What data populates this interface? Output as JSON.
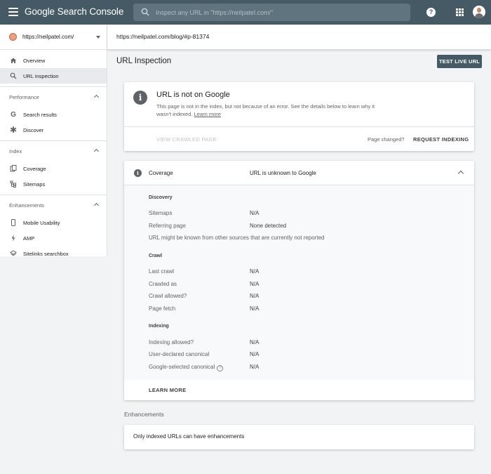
{
  "app": {
    "brand": "Google Search Console"
  },
  "search": {
    "placeholder": "Inspect any URL in \"https://neilpatel.com/\""
  },
  "sidebar": {
    "property": "https://neilpatel.com/",
    "top_items": [
      {
        "label": "Overview",
        "icon": "home-icon"
      },
      {
        "label": "URL inspection",
        "icon": "search-icon",
        "active": true
      }
    ],
    "sections": [
      {
        "title": "Performance",
        "items": [
          {
            "label": "Search results",
            "icon": "google-g-icon"
          },
          {
            "label": "Discover",
            "icon": "asterisk-icon"
          }
        ]
      },
      {
        "title": "Index",
        "items": [
          {
            "label": "Coverage",
            "icon": "file-copy-icon"
          },
          {
            "label": "Sitemaps",
            "icon": "sitemap-icon"
          }
        ]
      },
      {
        "title": "Enhancements",
        "items": [
          {
            "label": "Mobile Usability",
            "icon": "phone-icon"
          },
          {
            "label": "AMP",
            "icon": "bolt-icon"
          },
          {
            "label": "Sitelinks searchbox",
            "icon": "layers-icon"
          }
        ]
      }
    ]
  },
  "url_bar": {
    "url": "https://neilpatel.com/blog/#p-81374"
  },
  "page": {
    "title": "URL Inspection",
    "test_live_url": "TEST LIVE URL"
  },
  "status": {
    "title": "URL is not on Google",
    "description": "This page is not in the index, but not because of an error. See the details below to learn why it wasn't indexed.",
    "learn_more": "Learn more",
    "view_crawled": "VIEW CRAWLED PAGE",
    "page_changed": "Page changed?",
    "request_indexing": "REQUEST INDEXING"
  },
  "coverage": {
    "label": "Coverage",
    "value": "URL is unknown to Google",
    "discovery": {
      "heading": "Discovery",
      "sitemaps_label": "Sitemaps",
      "sitemaps_value": "N/A",
      "referring_label": "Referring page",
      "referring_value": "None detected",
      "note": "URL might be known from other sources that are currently not reported"
    },
    "crawl": {
      "heading": "Crawl",
      "rows": [
        {
          "label": "Last crawl",
          "value": "N/A"
        },
        {
          "label": "Crawled as",
          "value": "N/A"
        },
        {
          "label": "Crawl allowed?",
          "value": "N/A"
        },
        {
          "label": "Page fetch",
          "value": "N/A"
        }
      ]
    },
    "indexing": {
      "heading": "Indexing",
      "rows": [
        {
          "label": "Indexing allowed?",
          "value": "N/A"
        },
        {
          "label": "User-declared canonical",
          "value": "N/A"
        },
        {
          "label": "Google-selected canonical",
          "value": "N/A"
        }
      ]
    },
    "learn_more": "LEARN MORE"
  },
  "enhancements": {
    "label": "Enhancements",
    "message": "Only indexed URLs can have enhancements"
  }
}
